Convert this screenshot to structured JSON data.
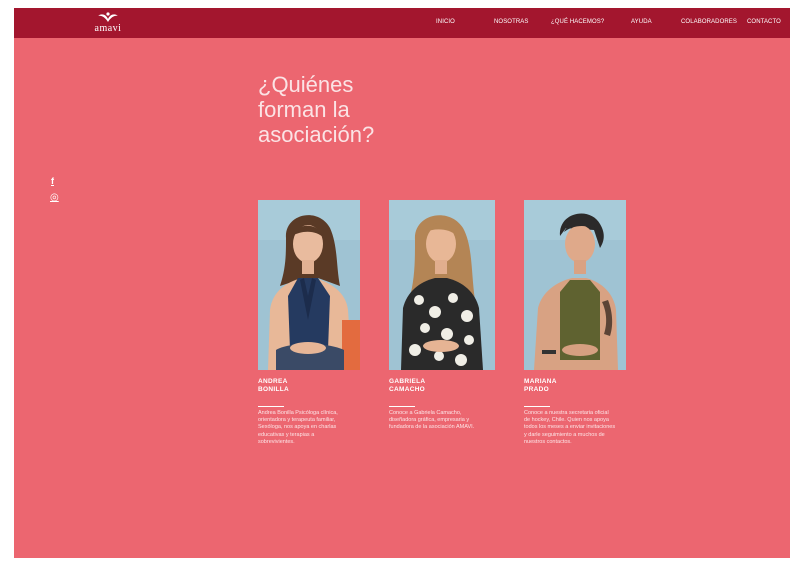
{
  "brand": {
    "logo_text": "amavi"
  },
  "nav": {
    "items": [
      {
        "label": "INICIO"
      },
      {
        "label": "NOSOTRAS"
      },
      {
        "label": "¿QUÉ HACEMOS?"
      },
      {
        "label": "AYUDA"
      },
      {
        "label": "COLABORADORES"
      },
      {
        "label": "CONTACTO"
      }
    ]
  },
  "hero": {
    "title_lines": [
      "¿Quiénes",
      "forman la",
      "asociación?"
    ]
  },
  "social": {
    "facebook": "f",
    "instagram": "◎"
  },
  "members": [
    {
      "name_line1": "ANDREA",
      "name_line2": "BONILLA",
      "bio": "Andrea Bonilla Psicóloga clínica, orientadora y terapeuta familiar, Sexóloga, nos apoya en charlas educativas y terapias a sobrevivientes."
    },
    {
      "name_line1": "GABRIELA",
      "name_line2": "CAMACHO",
      "bio": "Conoce a Gabriela Camacho, diseñadora gráfica, empresaria y fundadora de la asociación AMAVI."
    },
    {
      "name_line1": "MARIANA",
      "name_line2": "PRADO",
      "bio": "Conoce a nuestra secretaria oficial de hockey, Chile. Quien nos apoya todos los meses a enviar invitaciones y darle seguimiento a muchos de nuestros contactos."
    }
  ],
  "colors": {
    "topbar": "#a3162e",
    "page_background": "#ec6670",
    "photo_background": "#9fc3d3"
  },
  "icons": [
    "logo-bird-icon",
    "facebook-icon",
    "instagram-icon"
  ]
}
